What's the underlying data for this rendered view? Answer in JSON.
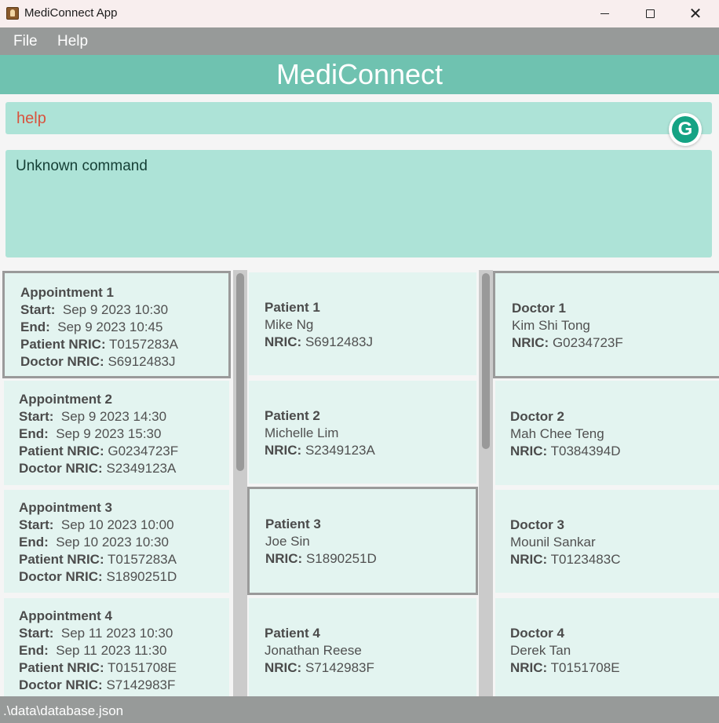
{
  "window": {
    "title": "MediConnect App"
  },
  "menu": {
    "file": "File",
    "help": "Help"
  },
  "header": {
    "title": "MediConnect"
  },
  "command": {
    "value": "help"
  },
  "result": {
    "text": "Unknown command"
  },
  "labels": {
    "start": "Start:",
    "end": "End:",
    "patient_nric": "Patient NRIC:",
    "doctor_nric": "Doctor NRIC:",
    "nric": "NRIC:"
  },
  "appointments": [
    {
      "title": "Appointment 1",
      "start": "Sep 9 2023 10:30",
      "end": "Sep 9 2023 10:45",
      "patient_nric": "T0157283A",
      "doctor_nric": "S6912483J"
    },
    {
      "title": "Appointment 2",
      "start": "Sep 9 2023 14:30",
      "end": "Sep 9 2023 15:30",
      "patient_nric": "G0234723F",
      "doctor_nric": "S2349123A"
    },
    {
      "title": "Appointment 3",
      "start": "Sep 10 2023 10:00",
      "end": "Sep 10 2023 10:30",
      "patient_nric": "T0157283A",
      "doctor_nric": "S1890251D"
    },
    {
      "title": "Appointment 4",
      "start": "Sep 11 2023 10:30",
      "end": "Sep 11 2023 11:30",
      "patient_nric": "T0151708E",
      "doctor_nric": "S7142983F"
    }
  ],
  "patients": [
    {
      "title": "Patient 1",
      "name": "Mike Ng",
      "nric": "S6912483J"
    },
    {
      "title": "Patient 2",
      "name": "Michelle Lim",
      "nric": "S2349123A"
    },
    {
      "title": "Patient 3",
      "name": "Joe Sin",
      "nric": "S1890251D"
    },
    {
      "title": "Patient 4",
      "name": "Jonathan Reese",
      "nric": "S7142983F"
    }
  ],
  "doctors": [
    {
      "title": "Doctor 1",
      "name": "Kim Shi Tong",
      "nric": "G0234723F"
    },
    {
      "title": "Doctor 2",
      "name": "Mah Chee Teng",
      "nric": "T0384394D"
    },
    {
      "title": "Doctor 3",
      "name": "Mounil Sankar",
      "nric": "T0123483C"
    },
    {
      "title": "Doctor 4",
      "name": "Derek Tan",
      "nric": "T0151708E"
    }
  ],
  "status": {
    "path": ".\\data\\database.json"
  },
  "icons": {
    "app": "app-icon",
    "minimize": "minimize-icon",
    "maximize": "maximize-icon",
    "close": "close-icon",
    "grammarly": "grammarly-icon"
  },
  "colors": {
    "banner": "#6fc2b0",
    "input_bg": "#ade3d7",
    "card_bg": "#e3f4f0",
    "menu_bg": "#979a99",
    "command_text": "#d9533e"
  }
}
